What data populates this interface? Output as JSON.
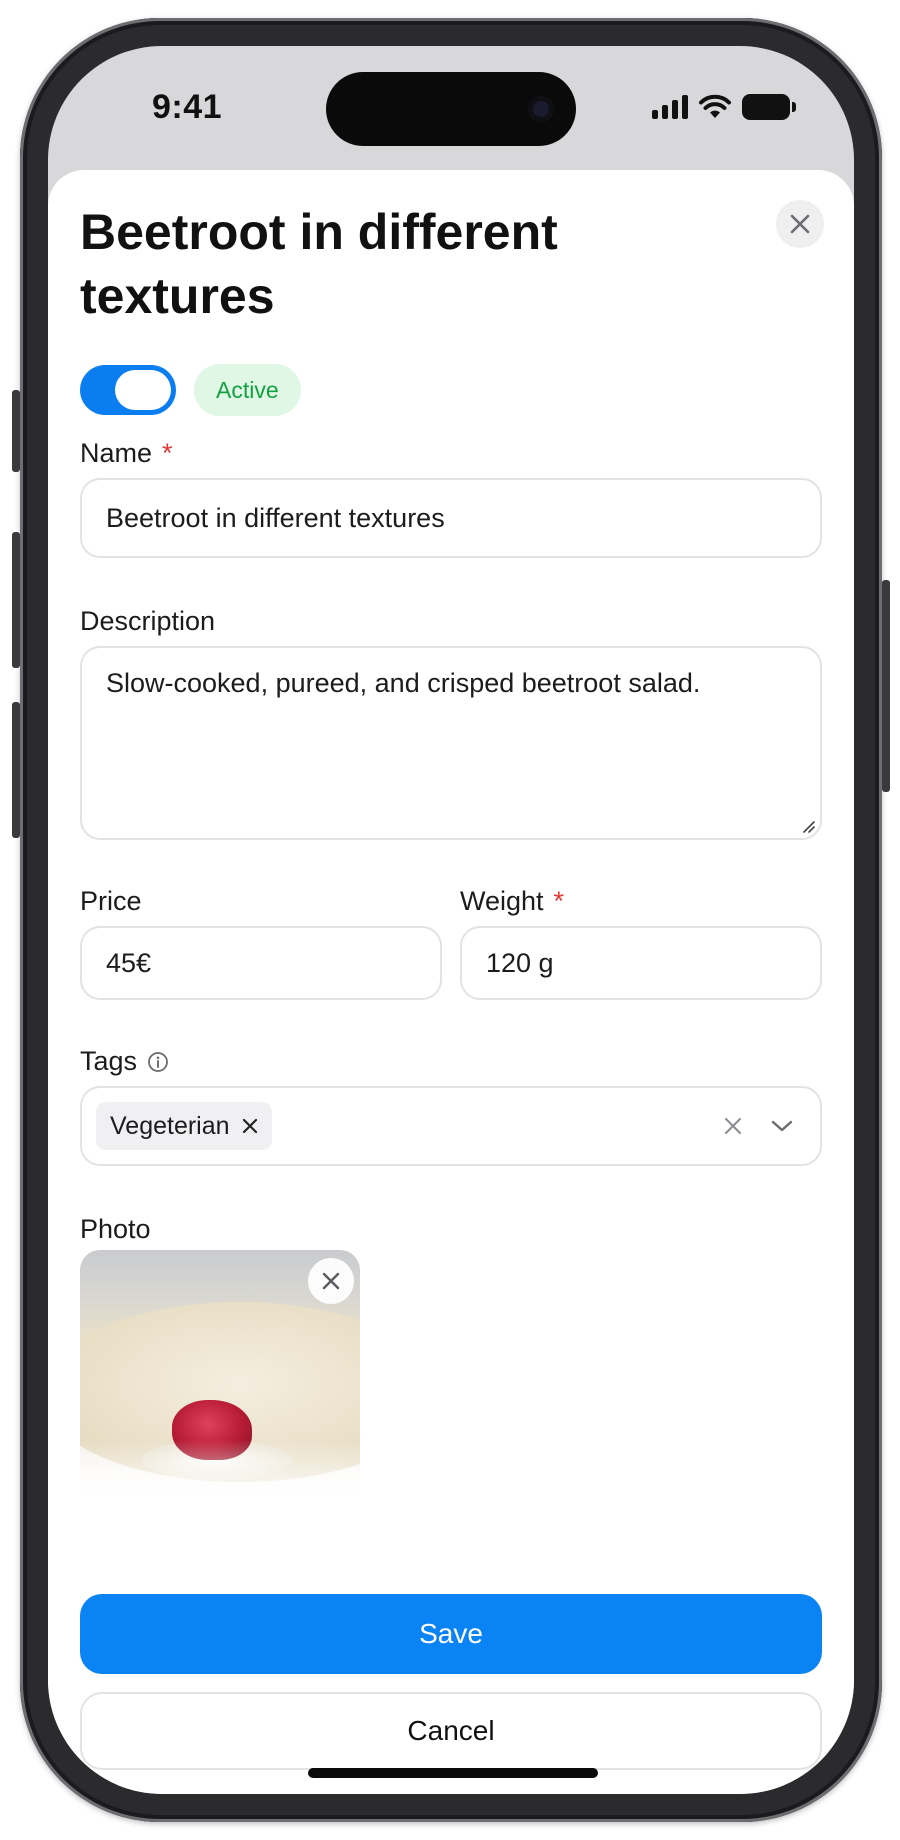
{
  "status_bar": {
    "time": "9:41"
  },
  "sheet": {
    "title": "Beetroot in different textures",
    "status": {
      "enabled": true,
      "badge": "Active"
    },
    "name": {
      "label": "Name",
      "required": "*",
      "value": "Beetroot in different textures"
    },
    "description": {
      "label": "Description",
      "value": "Slow-cooked, pureed, and crisped beetroot salad."
    },
    "price": {
      "label": "Price",
      "value": "45€"
    },
    "weight": {
      "label": "Weight",
      "required": "*",
      "value": "120 g"
    },
    "tags": {
      "label": "Tags",
      "selected": [
        "Vegeterian"
      ]
    },
    "photo": {
      "label": "Photo"
    },
    "save_label": "Save",
    "cancel_label": "Cancel"
  },
  "colors": {
    "accent": "#0a84f5",
    "toggle_on": "#0a7ef0",
    "badge_bg": "#e1f7e6",
    "badge_text": "#14a043",
    "required": "#e53935"
  },
  "icons": {
    "close": "close-icon",
    "info": "info-icon",
    "chip_remove": "close-icon",
    "clear": "clear-icon",
    "dropdown": "chevron-down-icon",
    "photo_remove": "close-icon"
  }
}
